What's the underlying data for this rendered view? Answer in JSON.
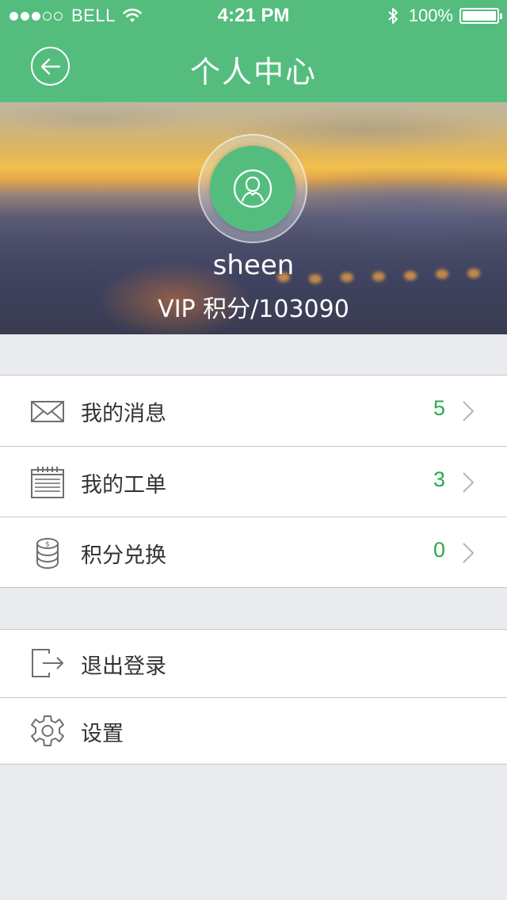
{
  "status_bar": {
    "carrier": "BELL",
    "time": "4:21 PM",
    "battery": "100%",
    "battery_level": 1.0,
    "signal_bars_filled": 3,
    "signal_bars_total": 5,
    "icons": [
      "wifi-icon",
      "bluetooth-icon",
      "battery-icon"
    ]
  },
  "nav": {
    "title": "个人中心",
    "back_icon": "back-arrow-icon"
  },
  "profile": {
    "username": "sheen",
    "vip_points": "VIP 积分/103090",
    "avatar_icon": "user-icon"
  },
  "menu_primary": [
    {
      "icon": "envelope-icon",
      "label": "我的消息",
      "count": "5"
    },
    {
      "icon": "calendar-icon",
      "label": "我的工单",
      "count": "3"
    },
    {
      "icon": "coins-icon",
      "label": "积分兑换",
      "count": "0"
    }
  ],
  "menu_secondary": [
    {
      "icon": "logout-icon",
      "label": "退出登录"
    },
    {
      "icon": "gear-icon",
      "label": "设置"
    }
  ],
  "colors": {
    "accent": "#54bd7e",
    "count": "#2aa84f",
    "background": "#e9ebef",
    "text": "#333333"
  }
}
